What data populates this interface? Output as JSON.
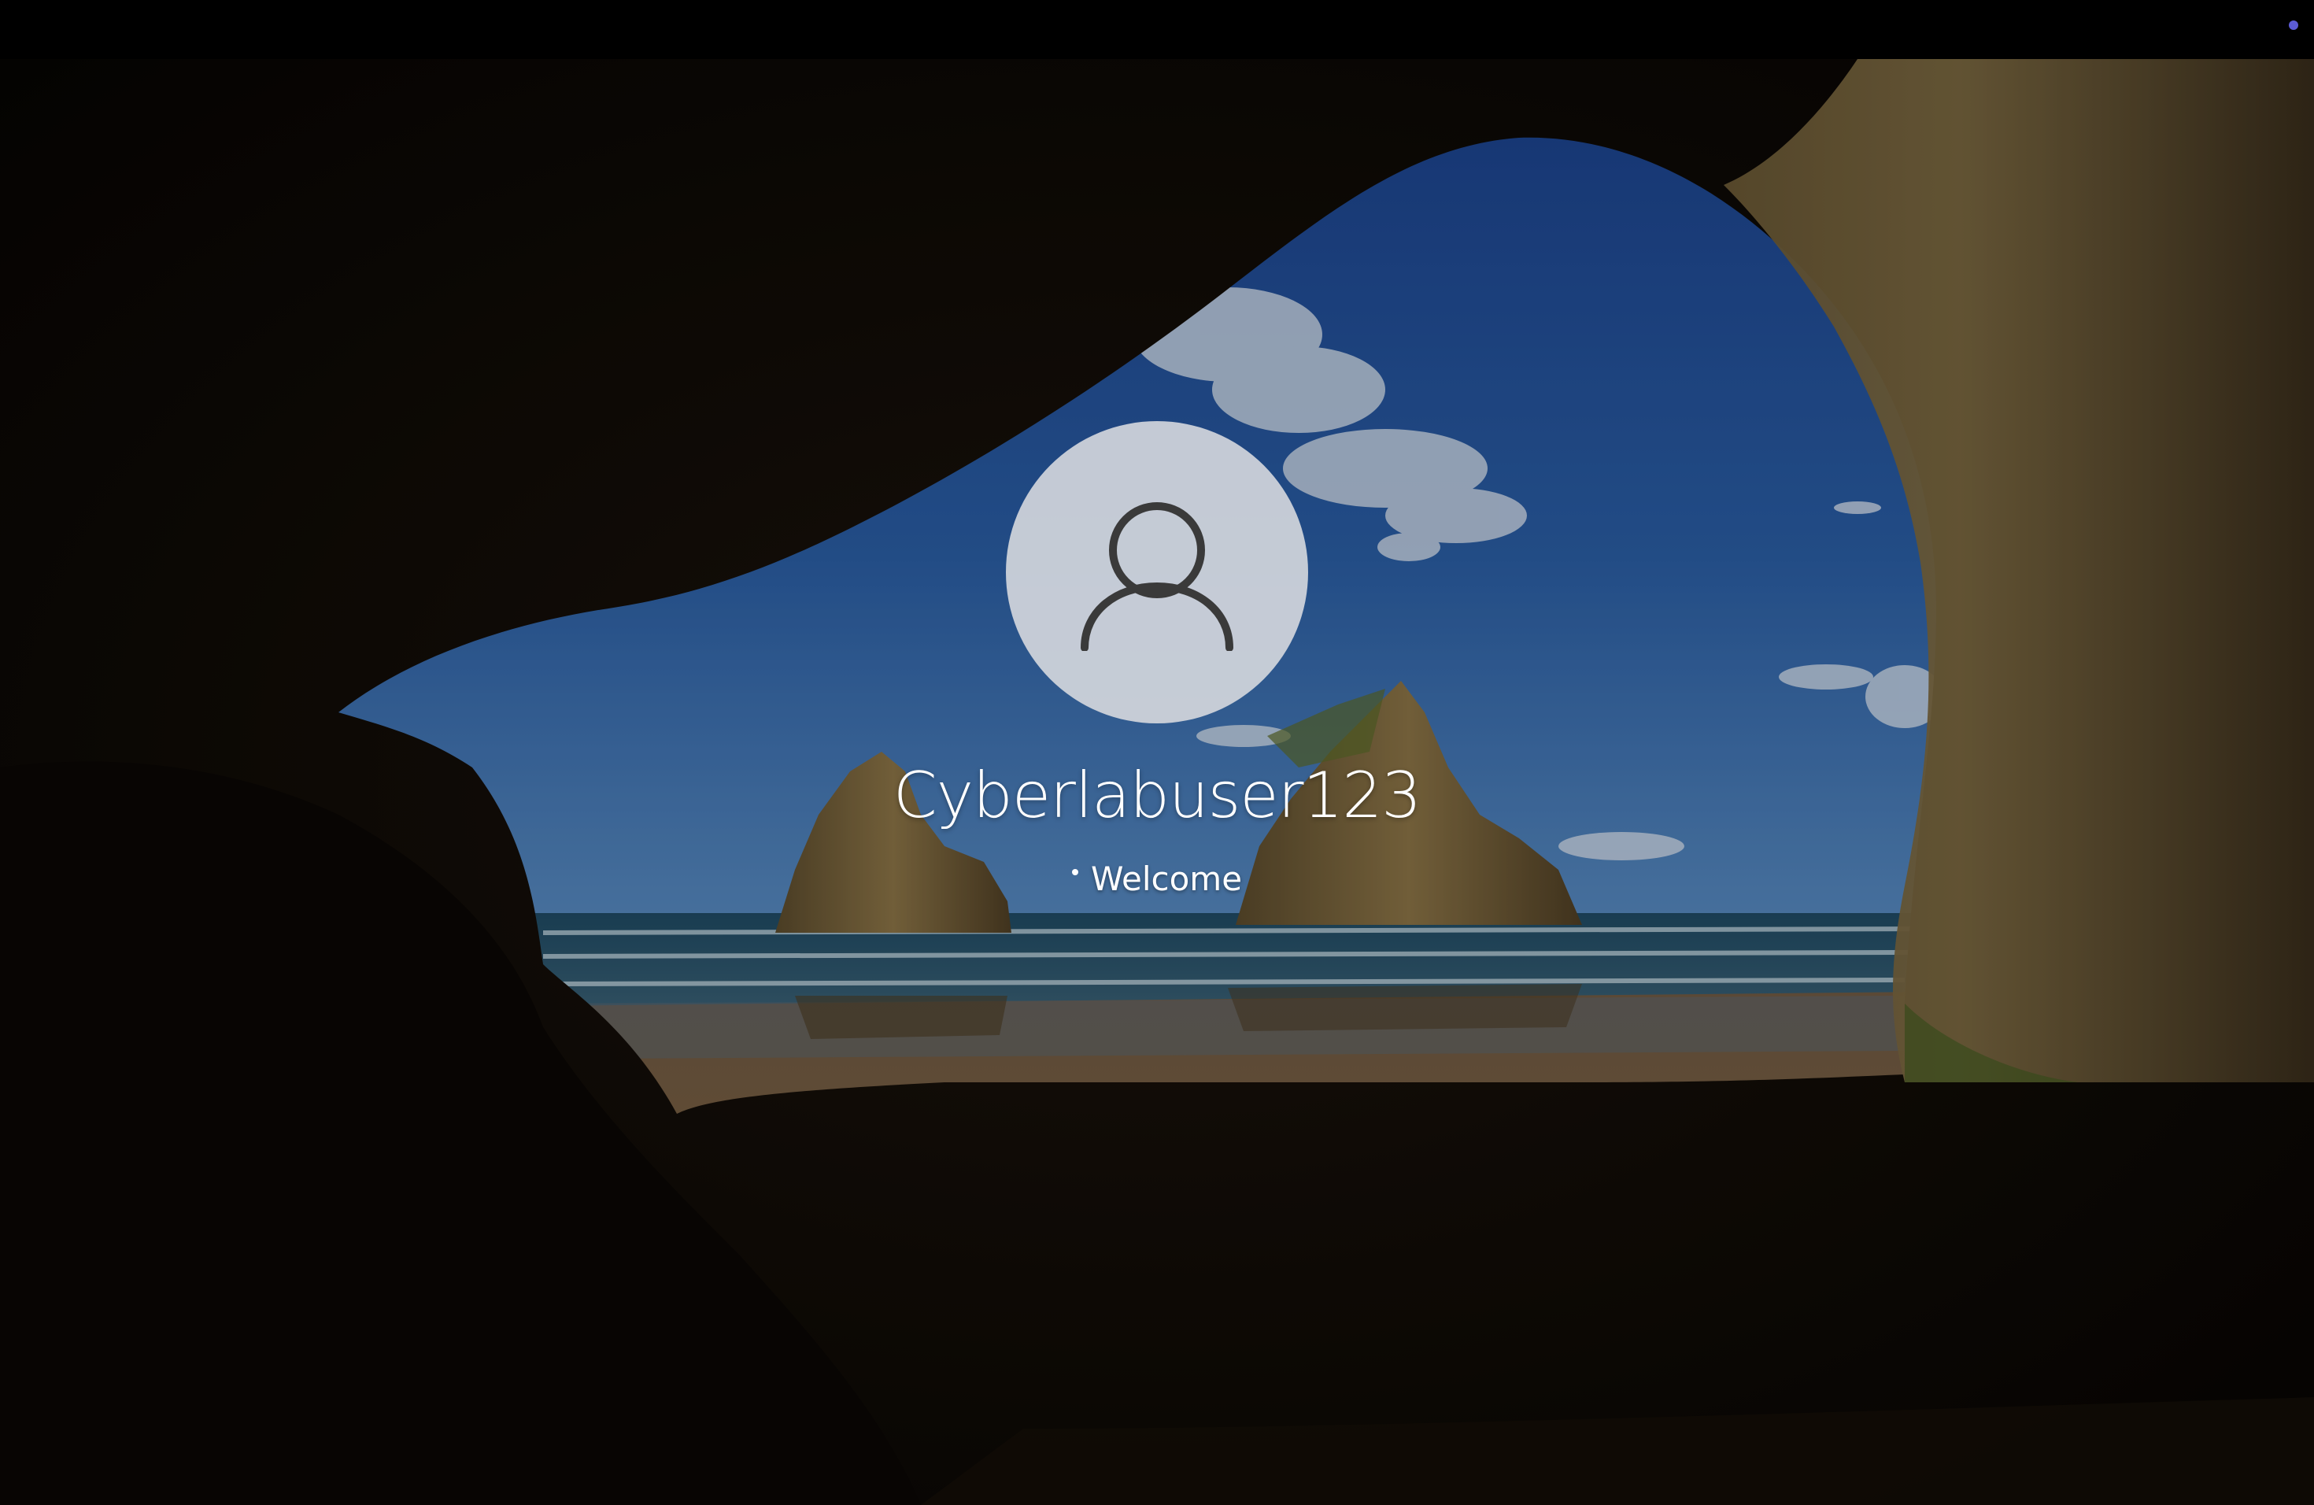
{
  "screen": {
    "type": "windows-lock-screen"
  },
  "user": {
    "name": "Cyberlabuser123",
    "avatar_icon": "user-icon"
  },
  "status": {
    "text": "Welcome",
    "indicator_icon": "loading-dots-icon"
  },
  "top_bar": {
    "indicator_color": "#5b5bd6"
  },
  "wallpaper": {
    "description_icon": "cave-beach-wallpaper"
  }
}
